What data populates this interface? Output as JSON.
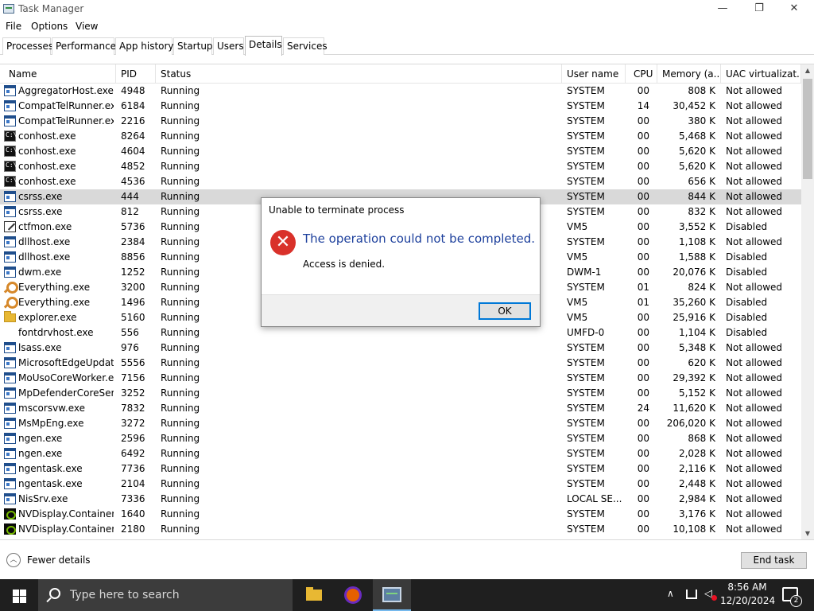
{
  "window": {
    "title": "Task Manager",
    "minimize": "—",
    "restore": "❐",
    "close": "✕"
  },
  "menu": [
    "File",
    "Options",
    "View"
  ],
  "tabs": [
    "Processes",
    "Performance",
    "App history",
    "Startup",
    "Users",
    "Details",
    "Services"
  ],
  "active_tab": "Details",
  "columns": {
    "name": "Name",
    "pid": "PID",
    "status": "Status",
    "user": "User name",
    "cpu": "CPU",
    "memory": "Memory (a...",
    "uac": "UAC virtualizat..."
  },
  "rows": [
    {
      "name": "AggregatorHost.exe",
      "pid": "4948",
      "status": "Running",
      "user": "SYSTEM",
      "cpu": "00",
      "mem": "808 K",
      "uac": "Not allowed",
      "icon": "window-icon"
    },
    {
      "name": "CompatTelRunner.exe",
      "pid": "6184",
      "status": "Running",
      "user": "SYSTEM",
      "cpu": "14",
      "mem": "30,452 K",
      "uac": "Not allowed",
      "icon": "window-icon"
    },
    {
      "name": "CompatTelRunner.exe",
      "pid": "2216",
      "status": "Running",
      "user": "SYSTEM",
      "cpu": "00",
      "mem": "380 K",
      "uac": "Not allowed",
      "icon": "window-icon"
    },
    {
      "name": "conhost.exe",
      "pid": "8264",
      "status": "Running",
      "user": "SYSTEM",
      "cpu": "00",
      "mem": "5,468 K",
      "uac": "Not allowed",
      "icon": "console-icon"
    },
    {
      "name": "conhost.exe",
      "pid": "4604",
      "status": "Running",
      "user": "SYSTEM",
      "cpu": "00",
      "mem": "5,620 K",
      "uac": "Not allowed",
      "icon": "console-icon"
    },
    {
      "name": "conhost.exe",
      "pid": "4852",
      "status": "Running",
      "user": "SYSTEM",
      "cpu": "00",
      "mem": "5,620 K",
      "uac": "Not allowed",
      "icon": "console-icon"
    },
    {
      "name": "conhost.exe",
      "pid": "4536",
      "status": "Running",
      "user": "SYSTEM",
      "cpu": "00",
      "mem": "656 K",
      "uac": "Not allowed",
      "icon": "console-icon"
    },
    {
      "name": "csrss.exe",
      "pid": "444",
      "status": "Running",
      "user": "SYSTEM",
      "cpu": "00",
      "mem": "844 K",
      "uac": "Not allowed",
      "icon": "window-icon",
      "selected": true
    },
    {
      "name": "csrss.exe",
      "pid": "812",
      "status": "Running",
      "user": "SYSTEM",
      "cpu": "00",
      "mem": "832 K",
      "uac": "Not allowed",
      "icon": "window-icon"
    },
    {
      "name": "ctfmon.exe",
      "pid": "5736",
      "status": "Running",
      "user": "VM5",
      "cpu": "00",
      "mem": "3,552 K",
      "uac": "Disabled",
      "icon": "edit-icon"
    },
    {
      "name": "dllhost.exe",
      "pid": "2384",
      "status": "Running",
      "user": "SYSTEM",
      "cpu": "00",
      "mem": "1,108 K",
      "uac": "Not allowed",
      "icon": "window-icon"
    },
    {
      "name": "dllhost.exe",
      "pid": "8856",
      "status": "Running",
      "user": "VM5",
      "cpu": "00",
      "mem": "1,588 K",
      "uac": "Disabled",
      "icon": "window-icon"
    },
    {
      "name": "dwm.exe",
      "pid": "1252",
      "status": "Running",
      "user": "DWM-1",
      "cpu": "00",
      "mem": "20,076 K",
      "uac": "Disabled",
      "icon": "window-icon"
    },
    {
      "name": "Everything.exe",
      "pid": "3200",
      "status": "Running",
      "user": "SYSTEM",
      "cpu": "01",
      "mem": "824 K",
      "uac": "Not allowed",
      "icon": "search-icon"
    },
    {
      "name": "Everything.exe",
      "pid": "1496",
      "status": "Running",
      "user": "VM5",
      "cpu": "01",
      "mem": "35,260 K",
      "uac": "Disabled",
      "icon": "search-icon"
    },
    {
      "name": "explorer.exe",
      "pid": "5160",
      "status": "Running",
      "user": "VM5",
      "cpu": "00",
      "mem": "25,916 K",
      "uac": "Disabled",
      "icon": "folder-icon"
    },
    {
      "name": "fontdrvhost.exe",
      "pid": "556",
      "status": "Running",
      "user": "UMFD-0",
      "cpu": "00",
      "mem": "1,104 K",
      "uac": "Disabled",
      "icon": "none"
    },
    {
      "name": "lsass.exe",
      "pid": "976",
      "status": "Running",
      "user": "SYSTEM",
      "cpu": "00",
      "mem": "5,348 K",
      "uac": "Not allowed",
      "icon": "window-icon"
    },
    {
      "name": "MicrosoftEdgeUpdat...",
      "pid": "5556",
      "status": "Running",
      "user": "SYSTEM",
      "cpu": "00",
      "mem": "620 K",
      "uac": "Not allowed",
      "icon": "window-icon"
    },
    {
      "name": "MoUsoCoreWorker.e...",
      "pid": "7156",
      "status": "Running",
      "user": "SYSTEM",
      "cpu": "00",
      "mem": "29,392 K",
      "uac": "Not allowed",
      "icon": "window-icon"
    },
    {
      "name": "MpDefenderCoreSer...",
      "pid": "3252",
      "status": "Running",
      "user": "SYSTEM",
      "cpu": "00",
      "mem": "5,152 K",
      "uac": "Not allowed",
      "icon": "window-icon"
    },
    {
      "name": "mscorsvw.exe",
      "pid": "7832",
      "status": "Running",
      "user": "SYSTEM",
      "cpu": "24",
      "mem": "11,620 K",
      "uac": "Not allowed",
      "icon": "window-icon"
    },
    {
      "name": "MsMpEng.exe",
      "pid": "3272",
      "status": "Running",
      "user": "SYSTEM",
      "cpu": "00",
      "mem": "206,020 K",
      "uac": "Not allowed",
      "icon": "window-icon"
    },
    {
      "name": "ngen.exe",
      "pid": "2596",
      "status": "Running",
      "user": "SYSTEM",
      "cpu": "00",
      "mem": "868 K",
      "uac": "Not allowed",
      "icon": "window-icon"
    },
    {
      "name": "ngen.exe",
      "pid": "6492",
      "status": "Running",
      "user": "SYSTEM",
      "cpu": "00",
      "mem": "2,028 K",
      "uac": "Not allowed",
      "icon": "window-icon"
    },
    {
      "name": "ngentask.exe",
      "pid": "7736",
      "status": "Running",
      "user": "SYSTEM",
      "cpu": "00",
      "mem": "2,116 K",
      "uac": "Not allowed",
      "icon": "window-icon"
    },
    {
      "name": "ngentask.exe",
      "pid": "2104",
      "status": "Running",
      "user": "SYSTEM",
      "cpu": "00",
      "mem": "2,448 K",
      "uac": "Not allowed",
      "icon": "window-icon"
    },
    {
      "name": "NisSrv.exe",
      "pid": "7336",
      "status": "Running",
      "user": "LOCAL SE...",
      "cpu": "00",
      "mem": "2,984 K",
      "uac": "Not allowed",
      "icon": "window-icon"
    },
    {
      "name": "NVDisplay.Container...",
      "pid": "1640",
      "status": "Running",
      "user": "SYSTEM",
      "cpu": "00",
      "mem": "3,176 K",
      "uac": "Not allowed",
      "icon": "nvidia-icon"
    },
    {
      "name": "NVDisplay.Container...",
      "pid": "2180",
      "status": "Running",
      "user": "SYSTEM",
      "cpu": "00",
      "mem": "10,108 K",
      "uac": "Not allowed",
      "icon": "nvidia-icon"
    }
  ],
  "footer": {
    "fewer_details": "Fewer details",
    "end_task": "End task"
  },
  "dialog": {
    "title": "Unable to terminate process",
    "main_instruction": "The operation could not be completed.",
    "content": "Access is denied.",
    "ok": "OK"
  },
  "taskbar": {
    "search_placeholder": "Type here to search",
    "time": "8:56 AM",
    "date": "12/20/2024",
    "notification_count": "2"
  },
  "colors": {
    "selection": "#d9d9d9",
    "dialog_heading": "#1c3f9c",
    "error": "#d9312a",
    "taskbar": "#1f1f1f",
    "focus": "#0078d7"
  }
}
